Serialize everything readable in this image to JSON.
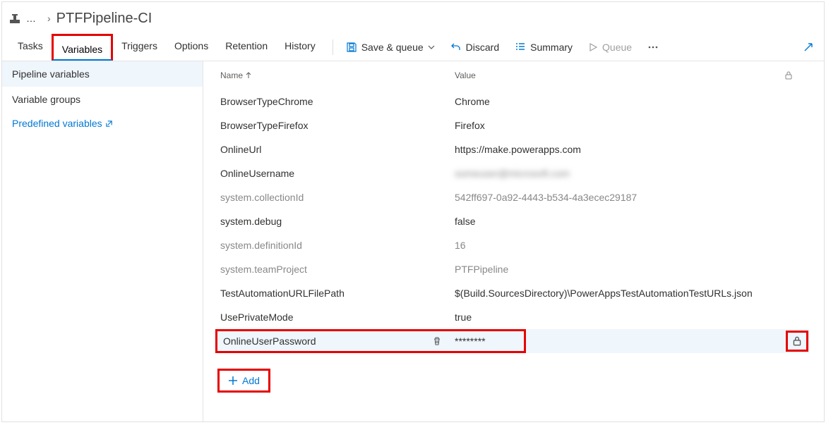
{
  "breadcrumb": {
    "ellipsis": "…",
    "separator": "›",
    "title": "PTFPipeline-CI"
  },
  "tabs": {
    "tasks": "Tasks",
    "variables": "Variables",
    "triggers": "Triggers",
    "options": "Options",
    "retention": "Retention",
    "history": "History"
  },
  "commands": {
    "save_queue": "Save & queue",
    "discard": "Discard",
    "summary": "Summary",
    "queue": "Queue"
  },
  "sidebar": {
    "pipeline_variables": "Pipeline variables",
    "variable_groups": "Variable groups",
    "predefined_variables": "Predefined variables"
  },
  "headers": {
    "name": "Name",
    "value": "Value"
  },
  "rows": [
    {
      "name": "BrowserTypeChrome",
      "value": "Chrome",
      "system": false
    },
    {
      "name": "BrowserTypeFirefox",
      "value": "Firefox",
      "system": false
    },
    {
      "name": "OnlineUrl",
      "value": "https://make.powerapps.com",
      "system": false
    },
    {
      "name": "OnlineUsername",
      "value": "someuser@microsoft.com",
      "system": false,
      "blurred": true
    },
    {
      "name": "system.collectionId",
      "value": "542ff697-0a92-4443-b534-4a3ecec29187",
      "system": true
    },
    {
      "name": "system.debug",
      "value": "false",
      "system": false
    },
    {
      "name": "system.definitionId",
      "value": "16",
      "system": true
    },
    {
      "name": "system.teamProject",
      "value": "PTFPipeline",
      "system": true
    },
    {
      "name": "TestAutomationURLFilePath",
      "value": "$(Build.SourcesDirectory)\\PowerAppsTestAutomationTestURLs.json",
      "system": false
    },
    {
      "name": "UsePrivateMode",
      "value": "true",
      "system": false
    }
  ],
  "selected_row": {
    "name": "OnlineUserPassword",
    "value": "********"
  },
  "add_label": "Add"
}
